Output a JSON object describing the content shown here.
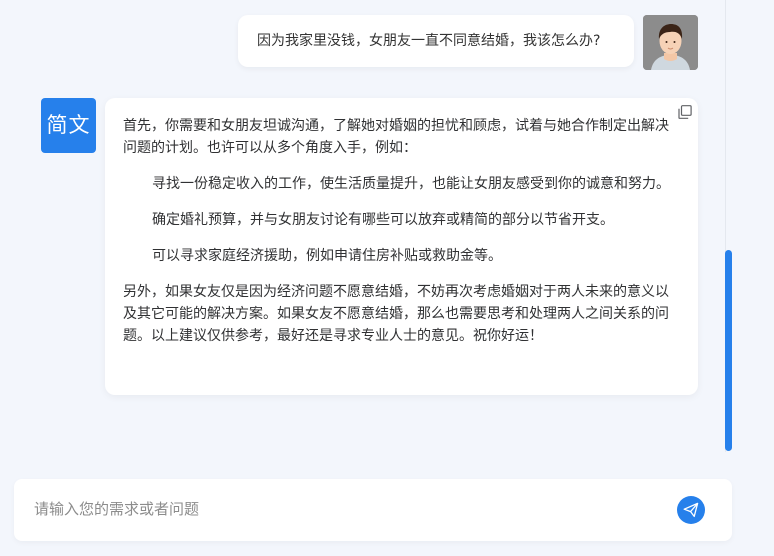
{
  "conversation": {
    "user_message": "因为我家里没钱，女朋友一直不同意结婚，我该怎么办?",
    "bot_avatar_label": "简文",
    "bot_reply": {
      "intro": "首先，你需要和女朋友坦诚沟通，了解她对婚姻的担忧和顾虑，试着与她合作制定出解决问题的计划。也许可以从多个角度入手，例如：",
      "items": [
        "寻找一份稳定收入的工作，使生活质量提升，也能让女朋友感受到你的诚意和努力。",
        "确定婚礼预算，并与女朋友讨论有哪些可以放弃或精简的部分以节省开支。",
        "可以寻求家庭经济援助，例如申请住房补贴或救助金等。"
      ],
      "conclusion": "另外，如果女友仅是因为经济问题不愿意结婚，不妨再次考虑婚姻对于两人未来的意义以及其它可能的解决方案。如果女友不愿意结婚，那么也需要思考和处理两人之间关系的问题。以上建议仅供参考，最好还是寻求专业人士的意见。祝你好运！"
    }
  },
  "input": {
    "placeholder": "请输入您的需求或者问题",
    "value": ""
  },
  "icons": {
    "copy": "copy-icon",
    "send": "paper-plane-icon",
    "user_avatar": "user-avatar-icon"
  },
  "colors": {
    "accent": "#2680eb",
    "background": "#f3f6fc",
    "bubble": "#ffffff"
  }
}
